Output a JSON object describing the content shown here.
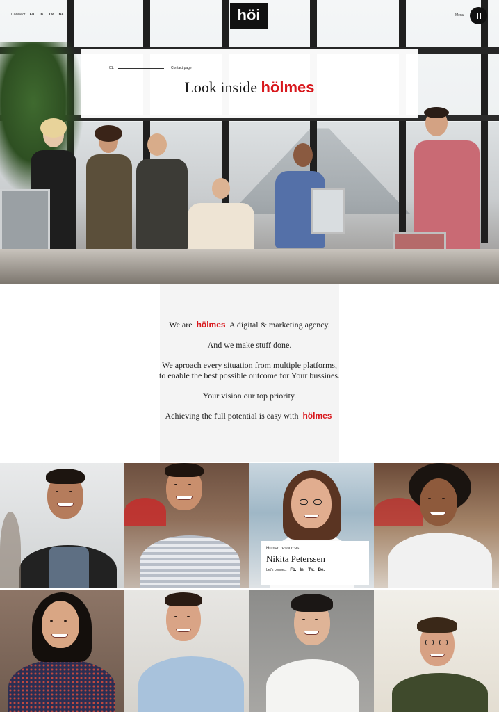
{
  "topbar": {
    "connect_label": "Connect",
    "social": [
      "Fb.",
      "In.",
      "Tw.",
      "Be."
    ],
    "logo": "höi",
    "menu_label": "Menu"
  },
  "hero": {
    "crumb_number": "01.",
    "crumb_label": "Contact page",
    "title_prefix": "Look inside",
    "title_brand": "hölmes"
  },
  "intro": {
    "line1_prefix": "We are",
    "line1_brand": "hölmes",
    "line1_suffix": "A digital & marketing agency.",
    "line2": "And we make stuff done.",
    "line3a": "We aproach every situation from multiple platforms,",
    "line3b": "to enable the best possible outcome for Your bussines.",
    "line4": "Your vision our top priority.",
    "line5_prefix": "Achieving the full potential is easy with",
    "line5_brand": "hölmes"
  },
  "team_card": {
    "role": "Human resources",
    "name": "Nikita Peterssen",
    "connect_label": "Let's connect",
    "social": [
      "Fb.",
      "In.",
      "Tw.",
      "Be."
    ]
  },
  "colors": {
    "accent": "#d8171c",
    "dark": "#111111"
  }
}
